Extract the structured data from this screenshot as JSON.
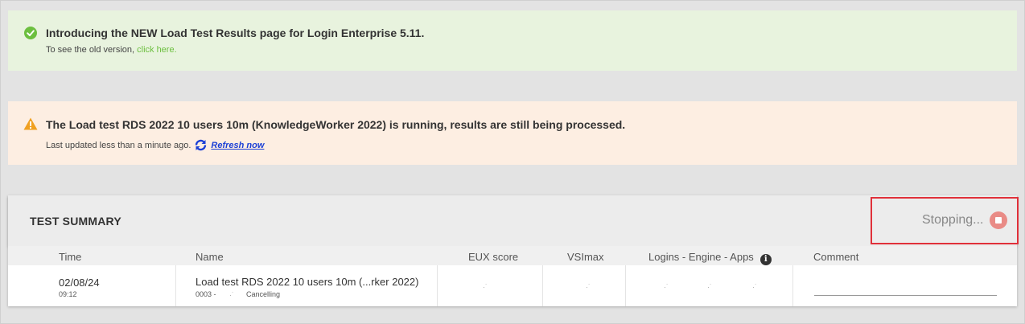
{
  "success_banner": {
    "title": "Introducing the NEW Load Test Results page for Login Enterprise 5.11.",
    "subtitle_prefix": "To see the old version, ",
    "link_text": "click here."
  },
  "warning_banner": {
    "title": "The Load test RDS 2022 10 users 10m (KnowledgeWorker 2022) is running, results are still being processed.",
    "subtitle": "Last updated less than a minute ago.",
    "refresh_label": "Refresh now"
  },
  "summary": {
    "title": "TEST SUMMARY",
    "status_text": "Stopping...",
    "columns": [
      "Time",
      "Name",
      "EUX score",
      "VSImax",
      "Logins - Engine - Apps",
      "Comment"
    ],
    "row": {
      "date": "02/08/24",
      "time": "09:12",
      "name": "Load test RDS 2022 10 users 10m (...rker 2022)",
      "id": "0003 -",
      "status": "Cancelling",
      "comment": ""
    }
  },
  "colors": {
    "success_bg": "#e8f3de",
    "success_accent": "#6cbf3f",
    "warning_bg": "#fdeee2",
    "warning_accent": "#f0a020",
    "link_blue": "#1a3fd6",
    "highlight_red": "#e0303a",
    "stop_button": "#e98b86"
  },
  "icons": {
    "success": "check-circle-icon",
    "warning": "warning-triangle-icon",
    "refresh": "refresh-icon",
    "info": "info-icon",
    "stop": "stop-icon"
  }
}
